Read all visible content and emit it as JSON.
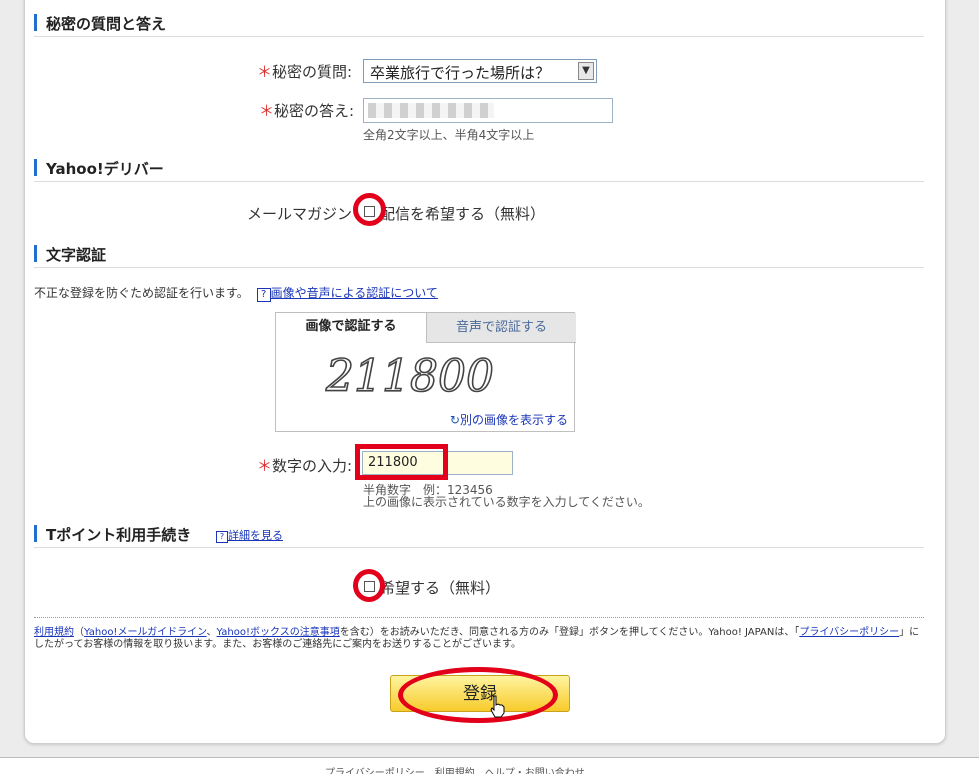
{
  "sections": {
    "secret": "秘密の質問と答え",
    "delivery": "Yahoo!デリバー",
    "captcha": "文字認証",
    "tpoint": "Tポイント利用手続き"
  },
  "secret": {
    "question_label": "秘密の質問:",
    "question_value": "卒業旅行で行った場所は？",
    "answer_label": "秘密の答え:",
    "answer_note": "全角2文字以上、半角4文字以上"
  },
  "delivery": {
    "mail_label": "メールマガジン",
    "mail_option": "配信を希望する（無料）"
  },
  "captcha": {
    "intro": "不正な登録を防ぐため認証を行います。",
    "help_icon": "?",
    "help_link": "画像や音声による認証について",
    "tab_image": "画像で認証する",
    "tab_audio": "音声で認証する",
    "image_text": "211800",
    "refresh_icon": "↻",
    "refresh_link": "別の画像を表示する",
    "input_label": "数字の入力:",
    "input_value": "211800",
    "note1": "半角数字　例：123456",
    "note2": "上の画像に表示されている数字を入力してください。"
  },
  "tpoint": {
    "help_icon": "?",
    "details_link": "詳細を見る",
    "option": "希望する（無料）"
  },
  "terms": {
    "link1": "利用規約",
    "text1": "（",
    "link2": "Yahoo!メールガイドライン",
    "text2": "、",
    "link3": "Yahoo!ボックスの注意事項",
    "text3": "を含む）をお読みいただき、同意される方のみ「登録」ボタンを押してください。Yahoo! JAPANは、「",
    "link4": "プライバシーポリシー",
    "text4": "」にしたがってお客様の情報を取り扱います。また、お客様のご連絡先にご案内をお送りすることがございます。"
  },
  "required_mark": "＊",
  "submit_label": "登録",
  "footer_text": "プライバシーポリシー　利用規約　ヘルプ・お問い合わせ"
}
